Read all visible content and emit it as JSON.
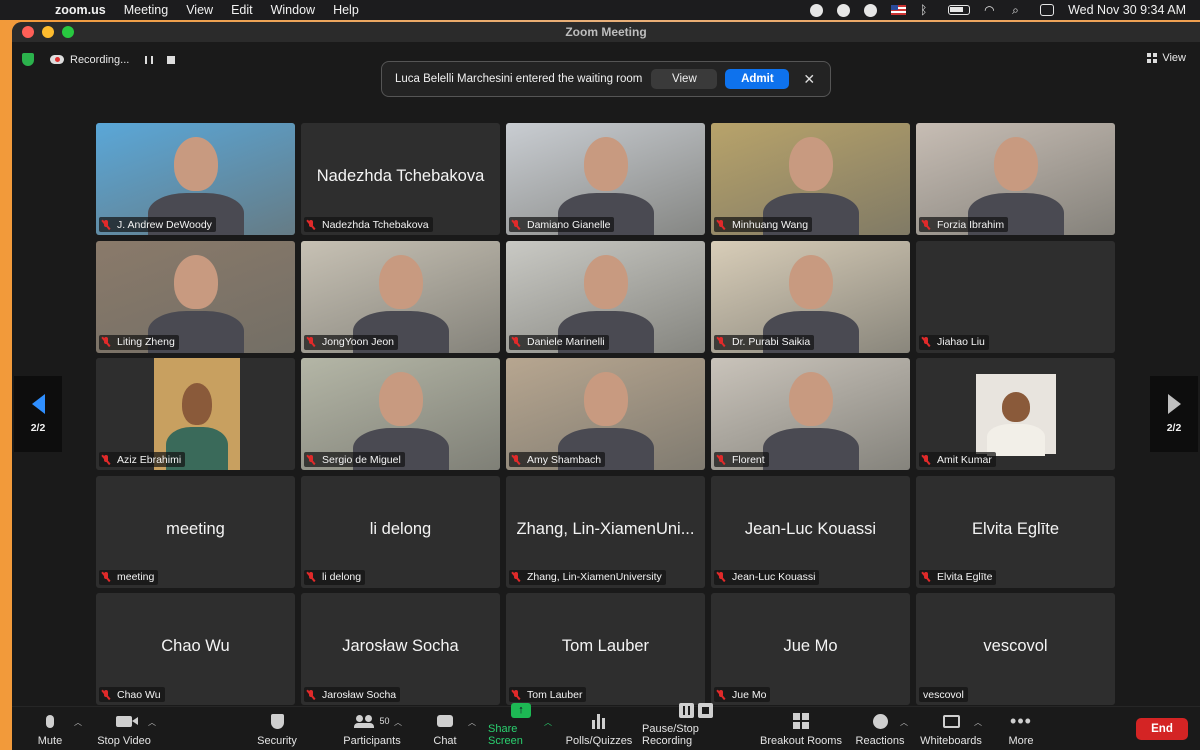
{
  "menubar": {
    "app": "zoom.us",
    "items": [
      "Meeting",
      "View",
      "Edit",
      "Window",
      "Help"
    ],
    "datetime": "Wed Nov 30  9:34 AM"
  },
  "window": {
    "title": "Zoom Meeting"
  },
  "meeting": {
    "recording_status": "Recording...",
    "view_label": "View",
    "notification": {
      "message": "Luca Belelli Marchesini entered the waiting room",
      "view_label": "View",
      "admit_label": "Admit"
    },
    "page_indicator_left": "2/2",
    "page_indicator_right": "2/2"
  },
  "tiles": [
    {
      "name": "J. Andrew DeWoody",
      "video": true,
      "muted": true,
      "bg": "#5aa7d8"
    },
    {
      "name": "Nadezhda Tchebakova",
      "big": "Nadezhda Tchebakova",
      "video": false,
      "muted": true
    },
    {
      "name": "Damiano Gianelle",
      "video": true,
      "muted": true,
      "bg": "#c9cdd2"
    },
    {
      "name": "Minhuang Wang",
      "video": true,
      "muted": true,
      "bg": "#b8a36a"
    },
    {
      "name": "Forzia Ibrahim",
      "video": true,
      "muted": true,
      "bg": "#c7bdb4"
    },
    {
      "name": "Liting Zheng",
      "video": true,
      "muted": true,
      "bg": "#8a7a6a"
    },
    {
      "name": "JongYoon Jeon",
      "video": true,
      "muted": true,
      "bg": "#c7c1b4"
    },
    {
      "name": "Daniele Marinelli",
      "video": true,
      "muted": true,
      "bg": "#c9c9c4"
    },
    {
      "name": "Dr. Purabi Saikia",
      "video": true,
      "muted": true,
      "bg": "#d8cdb8"
    },
    {
      "name": "Jiahao Liu",
      "video": false,
      "muted": true
    },
    {
      "name": "Aziz Ebrahimi",
      "video": true,
      "muted": true,
      "bg": "#c8a060",
      "small": true
    },
    {
      "name": "Sergio de Miguel",
      "video": true,
      "muted": true,
      "bg": "#b4b6a6"
    },
    {
      "name": "Amy Shambach",
      "video": true,
      "muted": true,
      "bg": "#b7a690"
    },
    {
      "name": "Florent",
      "video": true,
      "muted": true,
      "bg": "#c9c3ba"
    },
    {
      "name": "Amit Kumar",
      "video": true,
      "muted": true,
      "bg": "#e8e4de",
      "small": true
    },
    {
      "name": "meeting",
      "big": "meeting",
      "video": false,
      "muted": true
    },
    {
      "name": "li delong",
      "big": "li delong",
      "video": false,
      "muted": true
    },
    {
      "name": "Zhang, Lin-XiamenUniversity",
      "big": "Zhang, Lin-XiamenUni...",
      "video": false,
      "muted": true
    },
    {
      "name": "Jean-Luc Kouassi",
      "big": "Jean-Luc Kouassi",
      "video": false,
      "muted": true
    },
    {
      "name": "Elvita Eglīte",
      "big": "Elvita Eglīte",
      "video": false,
      "muted": true
    },
    {
      "name": "Chao Wu",
      "big": "Chao Wu",
      "video": false,
      "muted": true
    },
    {
      "name": "Jarosław Socha",
      "big": "Jarosław Socha",
      "video": false,
      "muted": true
    },
    {
      "name": "Tom Lauber",
      "big": "Tom Lauber",
      "video": false,
      "muted": true
    },
    {
      "name": "Jue Mo",
      "big": "Jue Mo",
      "video": false,
      "muted": true
    },
    {
      "name": "vescovol",
      "big": "vescovol",
      "video": false,
      "muted": false
    }
  ],
  "toolbar": {
    "mute": "Mute",
    "stop_video": "Stop Video",
    "security": "Security",
    "participants": "Participants",
    "participants_count": "50",
    "chat": "Chat",
    "share_screen": "Share Screen",
    "polls": "Polls/Quizzes",
    "recording": "Pause/Stop Recording",
    "breakout": "Breakout Rooms",
    "reactions": "Reactions",
    "whiteboards": "Whiteboards",
    "more": "More",
    "end": "End"
  },
  "colors": {
    "accent_blue": "#0e72ed",
    "end_red": "#d42424",
    "share_green": "#1db954",
    "muted_red": "#e02a2a"
  }
}
